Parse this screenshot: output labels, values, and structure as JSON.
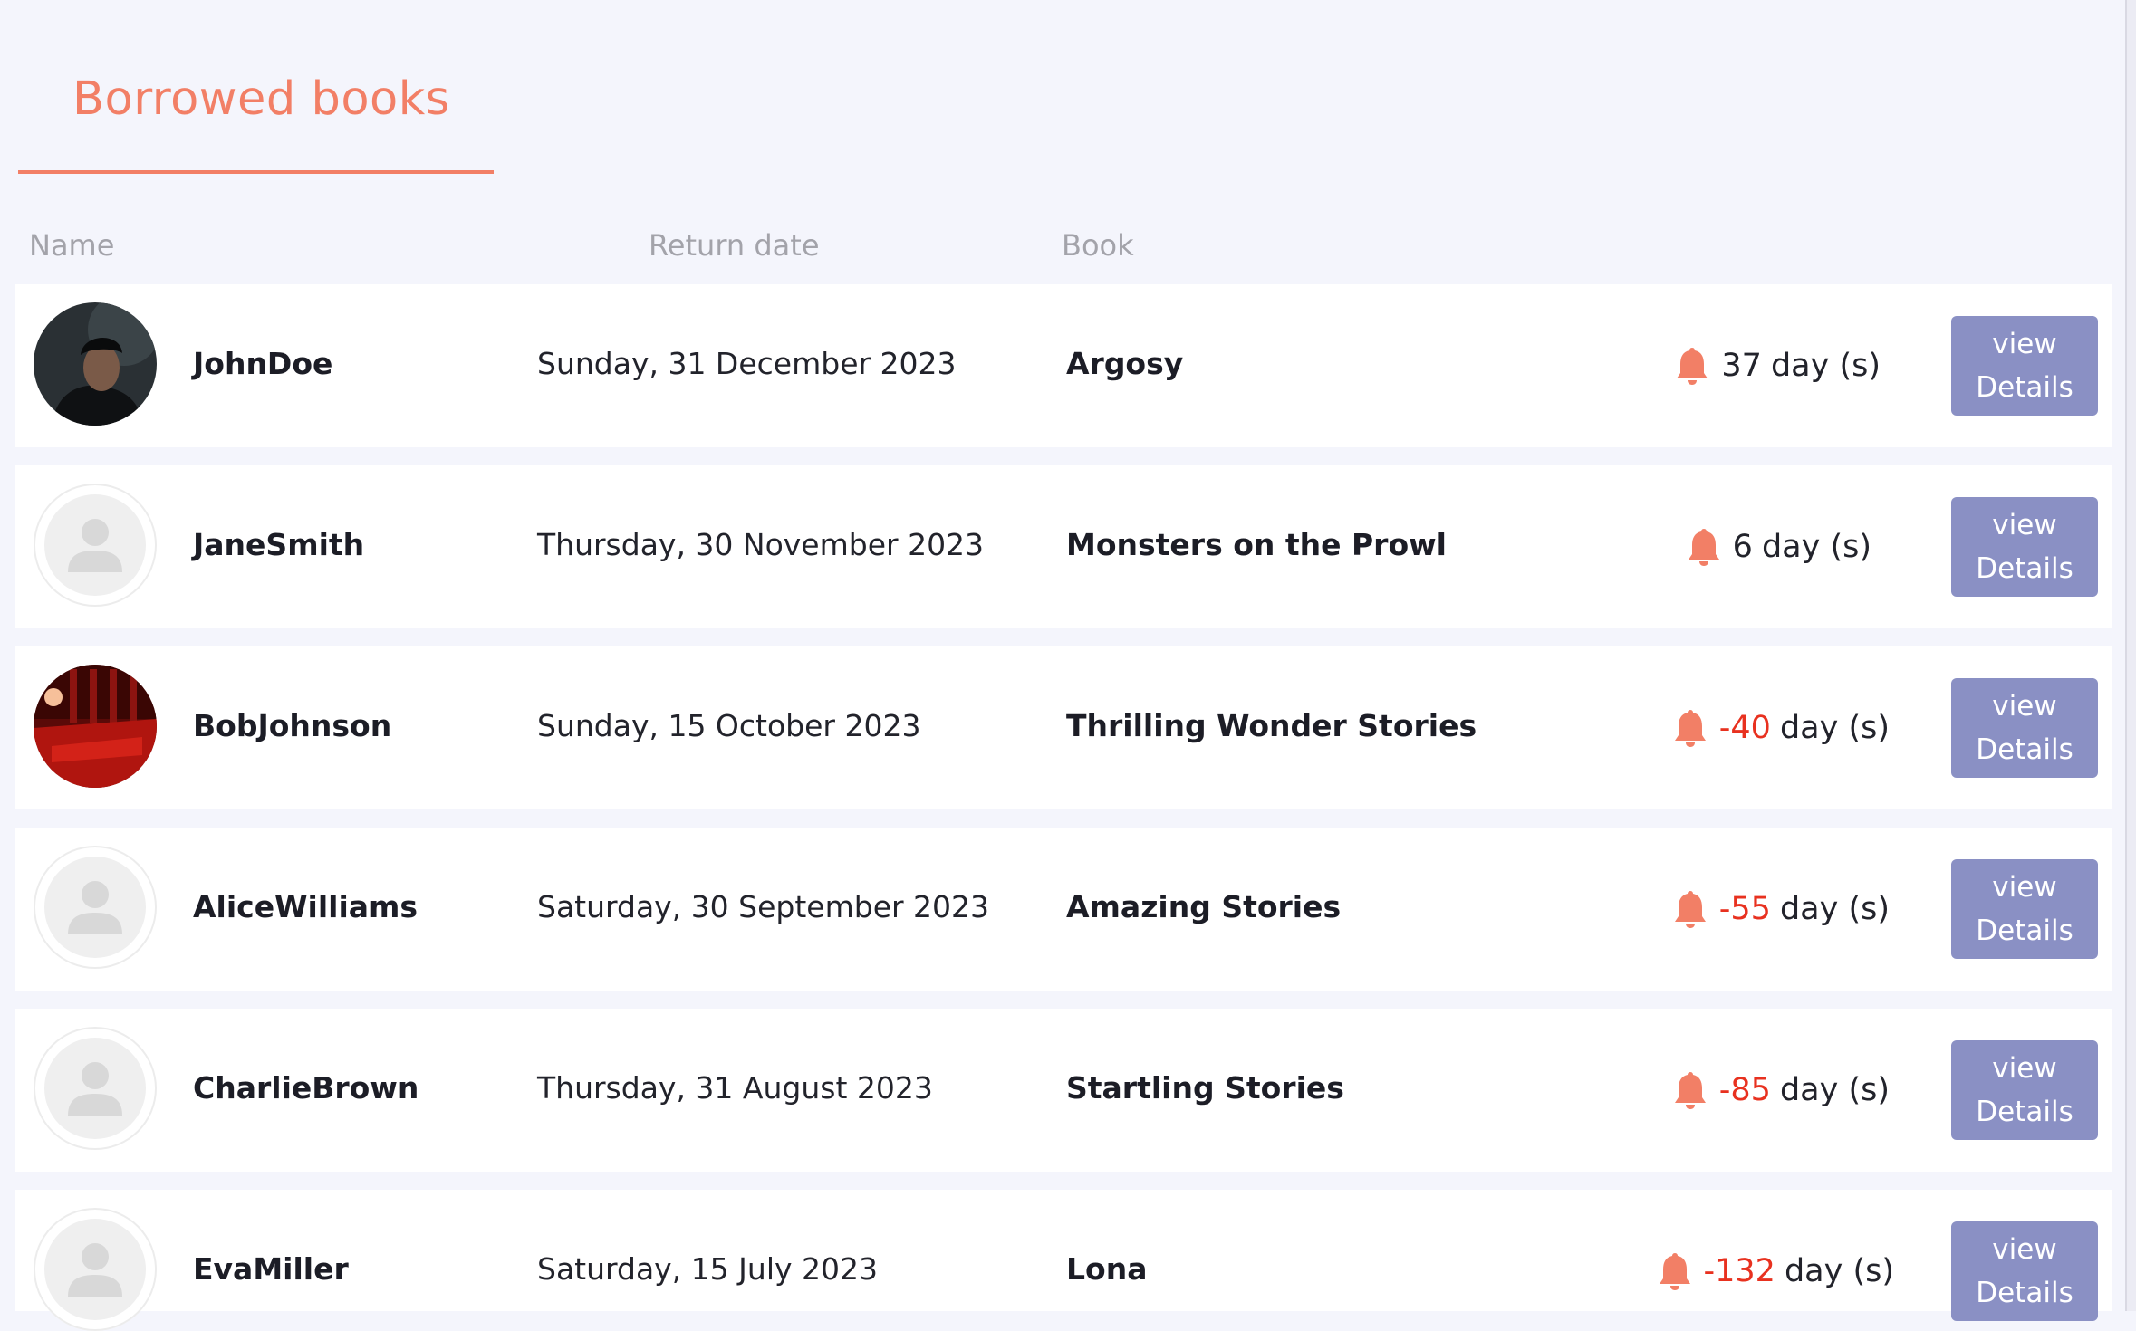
{
  "page": {
    "tab_title": "Borrowed books"
  },
  "table": {
    "headers": {
      "name": "Name",
      "return_date": "Return date",
      "book": "Book"
    },
    "rows": [
      {
        "name": "JohnDoe",
        "avatar": "photo-dark-portrait",
        "return_date": "Sunday, 31 December 2023",
        "book": "Argosy",
        "days": "37",
        "overdue": false,
        "unit": "day (s)",
        "button_line1": "view",
        "button_line2": "Details"
      },
      {
        "name": "JaneSmith",
        "avatar": "placeholder",
        "return_date": "Thursday, 30 November 2023",
        "book": "Monsters on the Prowl",
        "days": "6",
        "overdue": false,
        "unit": "day (s)",
        "button_line1": "view",
        "button_line2": "Details"
      },
      {
        "name": "BobJohnson",
        "avatar": "photo-red-theater",
        "return_date": "Sunday, 15 October 2023",
        "book": "Thrilling Wonder Stories",
        "days": "-40",
        "overdue": true,
        "unit": "day (s)",
        "button_line1": "view",
        "button_line2": "Details"
      },
      {
        "name": "AliceWilliams",
        "avatar": "placeholder",
        "return_date": "Saturday, 30 September 2023",
        "book": "Amazing Stories",
        "days": "-55",
        "overdue": true,
        "unit": "day (s)",
        "button_line1": "view",
        "button_line2": "Details"
      },
      {
        "name": "CharlieBrown",
        "avatar": "placeholder",
        "return_date": "Thursday, 31 August 2023",
        "book": "Startling Stories",
        "days": "-85",
        "overdue": true,
        "unit": "day (s)",
        "button_line1": "view",
        "button_line2": "Details"
      },
      {
        "name": "EvaMiller",
        "avatar": "placeholder",
        "return_date": "Saturday, 15 July 2023",
        "book": "Lona",
        "days": "-132",
        "overdue": true,
        "unit": "day (s)",
        "button_line1": "view",
        "button_line2": "Details"
      }
    ]
  },
  "colors": {
    "accent": "#f27f66",
    "button": "#8a90c4",
    "overdue": "#e8311f",
    "background": "#f4f5fc"
  },
  "icons": {
    "reminder": "bell-icon",
    "placeholder_avatar": "user-silhouette-icon"
  }
}
